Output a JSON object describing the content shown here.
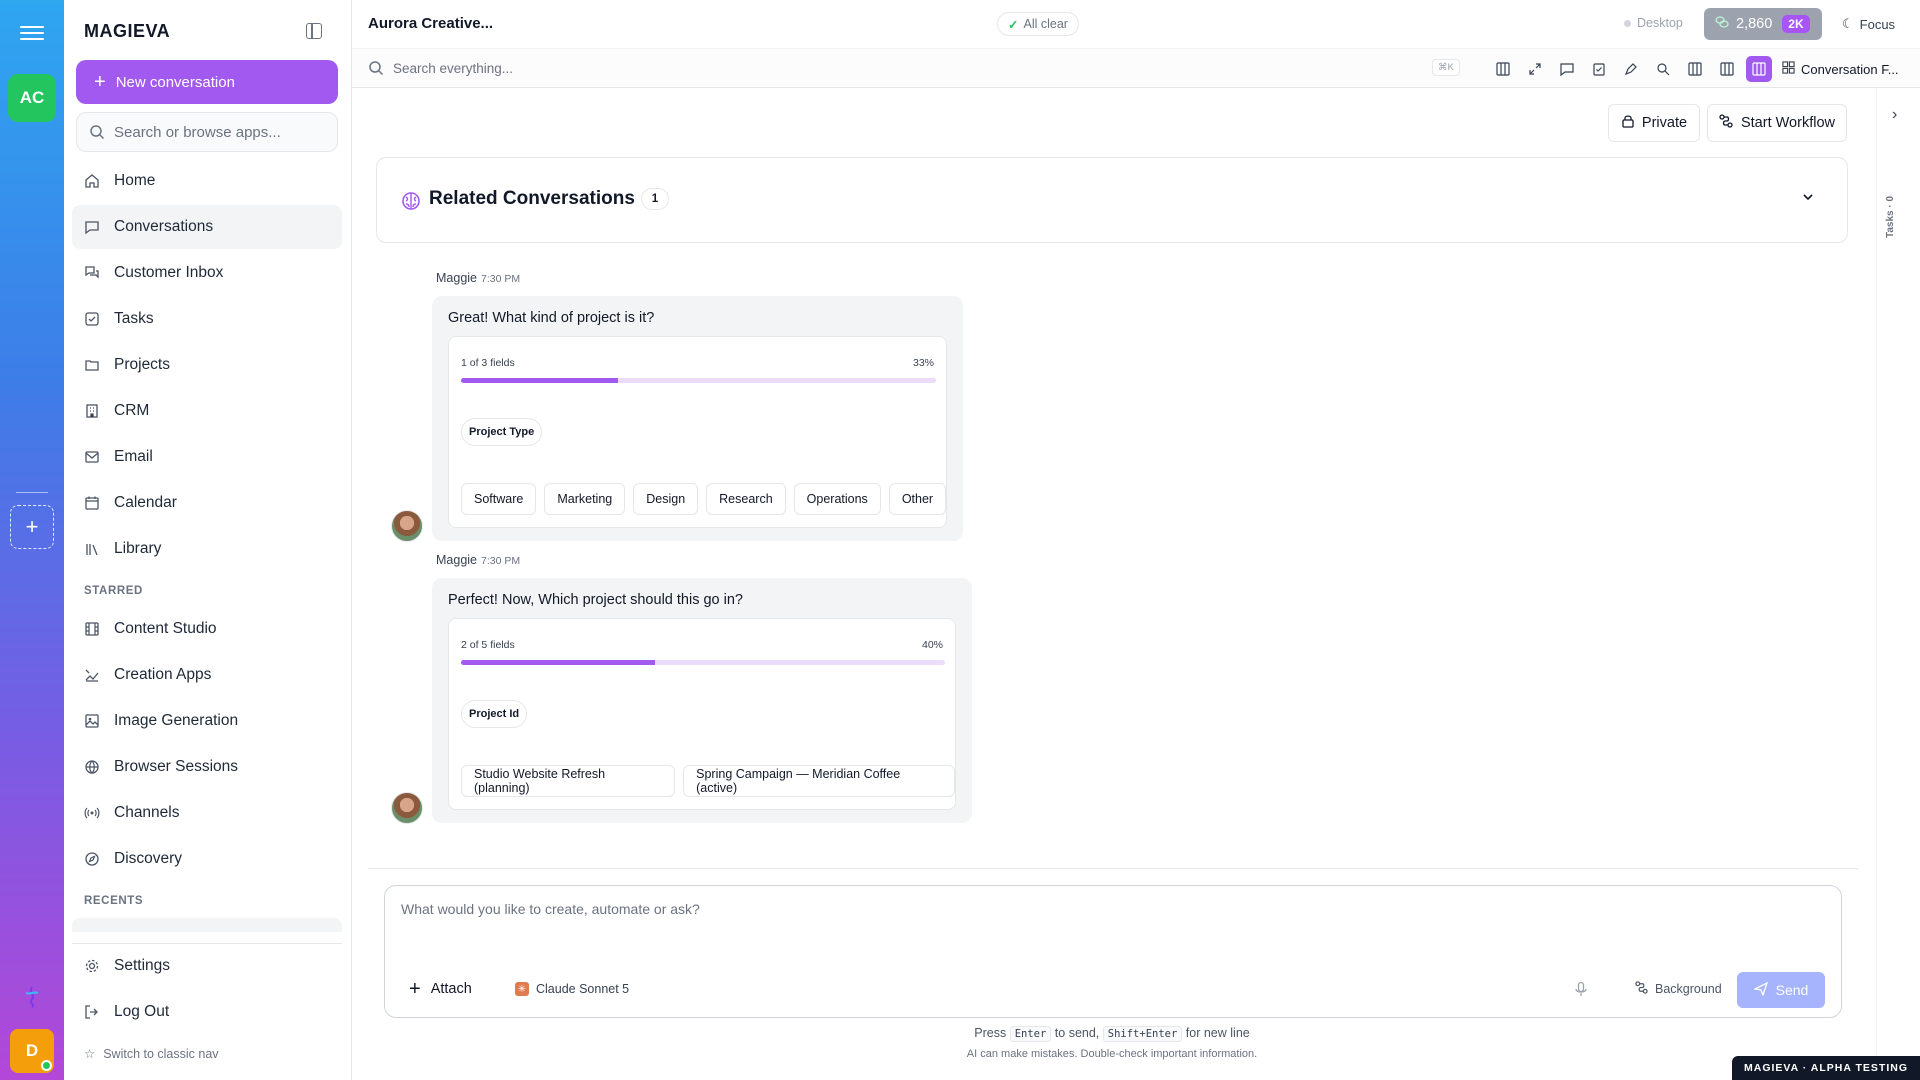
{
  "rail": {
    "workspace_initials": "AC",
    "user_initial": "D",
    "add_workspace_label": "+"
  },
  "sidebar": {
    "brand": "MAGIEVA",
    "new_conversation": "New conversation",
    "search_placeholder": "Search or browse apps...",
    "nav": [
      {
        "label": "Home",
        "icon": "home-icon"
      },
      {
        "label": "Conversations",
        "icon": "chat-icon",
        "active": true
      },
      {
        "label": "Customer Inbox",
        "icon": "inbox-icon"
      },
      {
        "label": "Tasks",
        "icon": "task-check-icon"
      },
      {
        "label": "Projects",
        "icon": "folder-icon"
      },
      {
        "label": "CRM",
        "icon": "building-icon"
      },
      {
        "label": "Email",
        "icon": "mail-icon"
      },
      {
        "label": "Calendar",
        "icon": "calendar-icon"
      },
      {
        "label": "Library",
        "icon": "library-icon"
      }
    ],
    "starred_label": "STARRED",
    "starred": [
      {
        "label": "Content Studio",
        "icon": "film-icon"
      },
      {
        "label": "Creation Apps",
        "icon": "apps-icon"
      },
      {
        "label": "Image Generation",
        "icon": "image-icon"
      },
      {
        "label": "Browser Sessions",
        "icon": "globe-icon"
      },
      {
        "label": "Channels",
        "icon": "broadcast-icon"
      },
      {
        "label": "Discovery",
        "icon": "compass-icon"
      }
    ],
    "recents_label": "RECENTS",
    "bottom": [
      {
        "label": "Settings",
        "icon": "gear-icon"
      },
      {
        "label": "Log Out",
        "icon": "logout-icon"
      }
    ],
    "classic_nav": "Switch to classic nav"
  },
  "header": {
    "title": "Aurora Creative...",
    "status": "All clear",
    "mode": "Desktop",
    "credits": "2,860",
    "credits_badge": "2K",
    "focus": "Focus"
  },
  "toolbar": {
    "search_placeholder": "Search everything...",
    "shortcut": "⌘K",
    "view_label": "Conversation F..."
  },
  "right_rail": {
    "tasks_label": "Tasks · 0"
  },
  "actions": {
    "private": "Private",
    "start_workflow": "Start Workflow"
  },
  "related": {
    "title": "Related Conversations",
    "count": "1"
  },
  "messages": [
    {
      "author": "Maggie",
      "time": "7:30 PM",
      "text": "Great! What kind of project is it?",
      "progress_text": "1 of 3 fields",
      "percent_text": "33%",
      "progress": 0.33,
      "field": "Project Type",
      "options": [
        "Software",
        "Marketing",
        "Design",
        "Research",
        "Operations",
        "Other"
      ]
    },
    {
      "author": "Maggie",
      "time": "7:30 PM",
      "text": "Perfect! Now, Which project should this go in?",
      "progress_text": "2 of 5 fields",
      "percent_text": "40%",
      "progress": 0.4,
      "field": "Project Id",
      "options": [
        "Studio Website Refresh (planning)",
        "Spring Campaign — Meridian Coffee (active)"
      ]
    }
  ],
  "composer": {
    "placeholder": "What would you like to create, automate or ask?",
    "attach": "Attach",
    "model": "Claude Sonnet 5",
    "background": "Background",
    "send": "Send",
    "hint_press": "Press",
    "hint_enter": "Enter",
    "hint_to_send": "to send,",
    "hint_shift_enter": "Shift+Enter",
    "hint_new_line": "for new line",
    "disclaimer": "AI can make mistakes. Double-check important information."
  },
  "footer_badge": "MAGIEVA · ALPHA TESTING",
  "colors": {
    "accent": "#a259f0",
    "progress_track": "#ecdcfb",
    "workspace": "#22c55e",
    "user": "#f59e0b",
    "send_disabled": "#a5b4fc"
  }
}
